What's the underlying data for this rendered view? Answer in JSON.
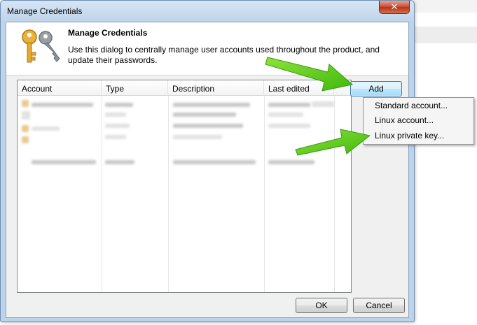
{
  "window": {
    "title": "Manage Credentials",
    "close_label": "✕"
  },
  "header": {
    "title": "Manage Credentials",
    "description": "Use this dialog to centrally manage user accounts used throughout the product, and update their passwords."
  },
  "list": {
    "columns": [
      "Account",
      "Type",
      "Description",
      "Last edited"
    ]
  },
  "buttons": {
    "add": "Add",
    "ok": "OK",
    "cancel": "Cancel"
  },
  "add_menu": {
    "items": [
      "Standard account...",
      "Linux account...",
      "Linux private key..."
    ]
  },
  "colors": {
    "annotation_arrow": "#5fcf1a",
    "key_icon": "#e3a92e"
  },
  "icons": [
    "key-icon",
    "close-icon"
  ]
}
